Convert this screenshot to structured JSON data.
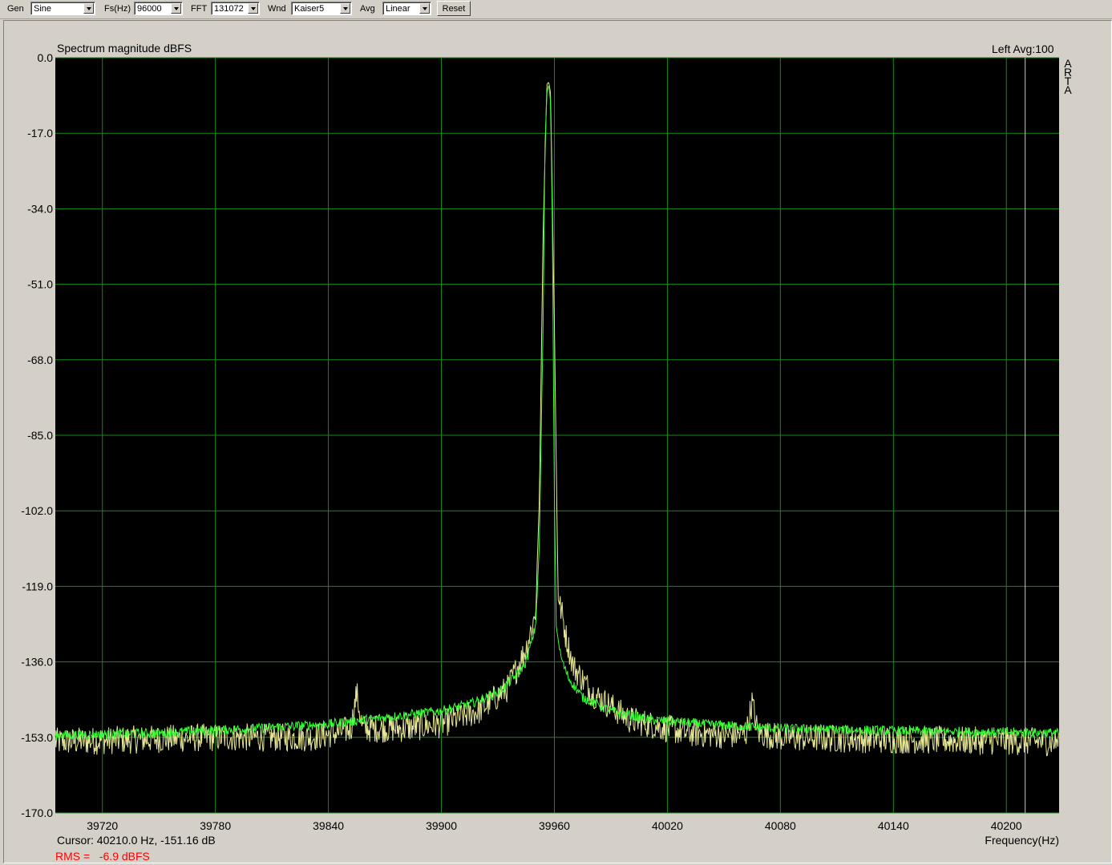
{
  "toolbar": {
    "gen_label": "Gen",
    "gen_value": "Sine",
    "fs_label": "Fs(Hz)",
    "fs_value": "96000",
    "fft_label": "FFT",
    "fft_value": "131072",
    "wnd_label": "Wnd",
    "wnd_value": "Kaiser5",
    "avg_label": "Avg",
    "avg_value": "Linear",
    "reset_label": "Reset"
  },
  "plot": {
    "title": "Spectrum magnitude dBFS",
    "channel_info": "Left  Avg:100",
    "brand_letters": [
      "A",
      "R",
      "T",
      "A"
    ],
    "cursor_label": "Cursor:",
    "cursor_value": "40210.0 Hz, -151.16 dB",
    "x_axis_label": "Frequency(Hz)",
    "rms_label": "RMS =",
    "rms_value": "-6.9 dBFS"
  },
  "colors": {
    "background": "#000000",
    "grid": "#148c14",
    "trace_green": "#32ff32",
    "trace_yellow": "#e6e696",
    "cursor_line": "#c8c8c8",
    "rms_text": "#ff0000"
  },
  "chart_data": {
    "type": "line",
    "title": "Spectrum magnitude dBFS",
    "xlabel": "Frequency(Hz)",
    "ylabel": "",
    "xlim": [
      39695,
      40228
    ],
    "ylim": [
      -170,
      0
    ],
    "grid": true,
    "x_ticks": [
      39720,
      39780,
      39840,
      39900,
      39960,
      40020,
      40080,
      40140,
      40200
    ],
    "y_ticks": [
      "0.0",
      "-17.0",
      "-34.0",
      "-51.0",
      "-68.0",
      "-85.0",
      "-102.0",
      "-119.0",
      "-136.0",
      "-153.0",
      "-170.0"
    ],
    "cursor_x": 40210,
    "series": [
      {
        "color": "#32ff32",
        "x": [
          39695,
          39750,
          39800,
          39840,
          39860,
          39880,
          39900,
          39915,
          39930,
          39940,
          39945,
          39950,
          39952,
          39954,
          39955,
          39956,
          39957,
          39958,
          39959,
          39960,
          39961,
          39962,
          39963,
          39965,
          39968,
          39975,
          39990,
          40010,
          40040,
          40080,
          40140,
          40228
        ],
        "y": [
          -152.5,
          -152.0,
          -151.0,
          -150.0,
          -149.0,
          -148.0,
          -147.0,
          -145.5,
          -143.0,
          -139.0,
          -136.0,
          -128.0,
          -110.0,
          -60.0,
          -20.0,
          -8.0,
          -6.0,
          -10.0,
          -40.0,
          -100.0,
          -128.0,
          -131.0,
          -134.0,
          -137.0,
          -140.0,
          -144.0,
          -147.0,
          -149.0,
          -150.0,
          -151.0,
          -151.5,
          -152.0
        ]
      },
      {
        "color": "#e6e696",
        "x": [
          39695,
          39780,
          39830,
          39845,
          39852,
          39855,
          39858,
          39865,
          39880,
          39900,
          39920,
          39935,
          39945,
          39950,
          39952,
          39954,
          39956,
          39957,
          39958,
          39960,
          39962,
          39964,
          39966,
          39970,
          39980,
          40000,
          40030,
          40055,
          40062,
          40065,
          40068,
          40080,
          40140,
          40228
        ],
        "y": [
          -154.0,
          -153.0,
          -153.0,
          -152.0,
          -151.0,
          -143.0,
          -151.0,
          -151.0,
          -151.0,
          -150.0,
          -147.0,
          -142.0,
          -133.0,
          -125.0,
          -100.0,
          -40.0,
          -6.0,
          -5.5,
          -8.0,
          -60.0,
          -122.0,
          -125.0,
          -130.0,
          -137.0,
          -143.0,
          -149.0,
          -152.0,
          -152.5,
          -152.0,
          -145.0,
          -152.0,
          -153.0,
          -153.5,
          -154.0
        ]
      }
    ]
  }
}
